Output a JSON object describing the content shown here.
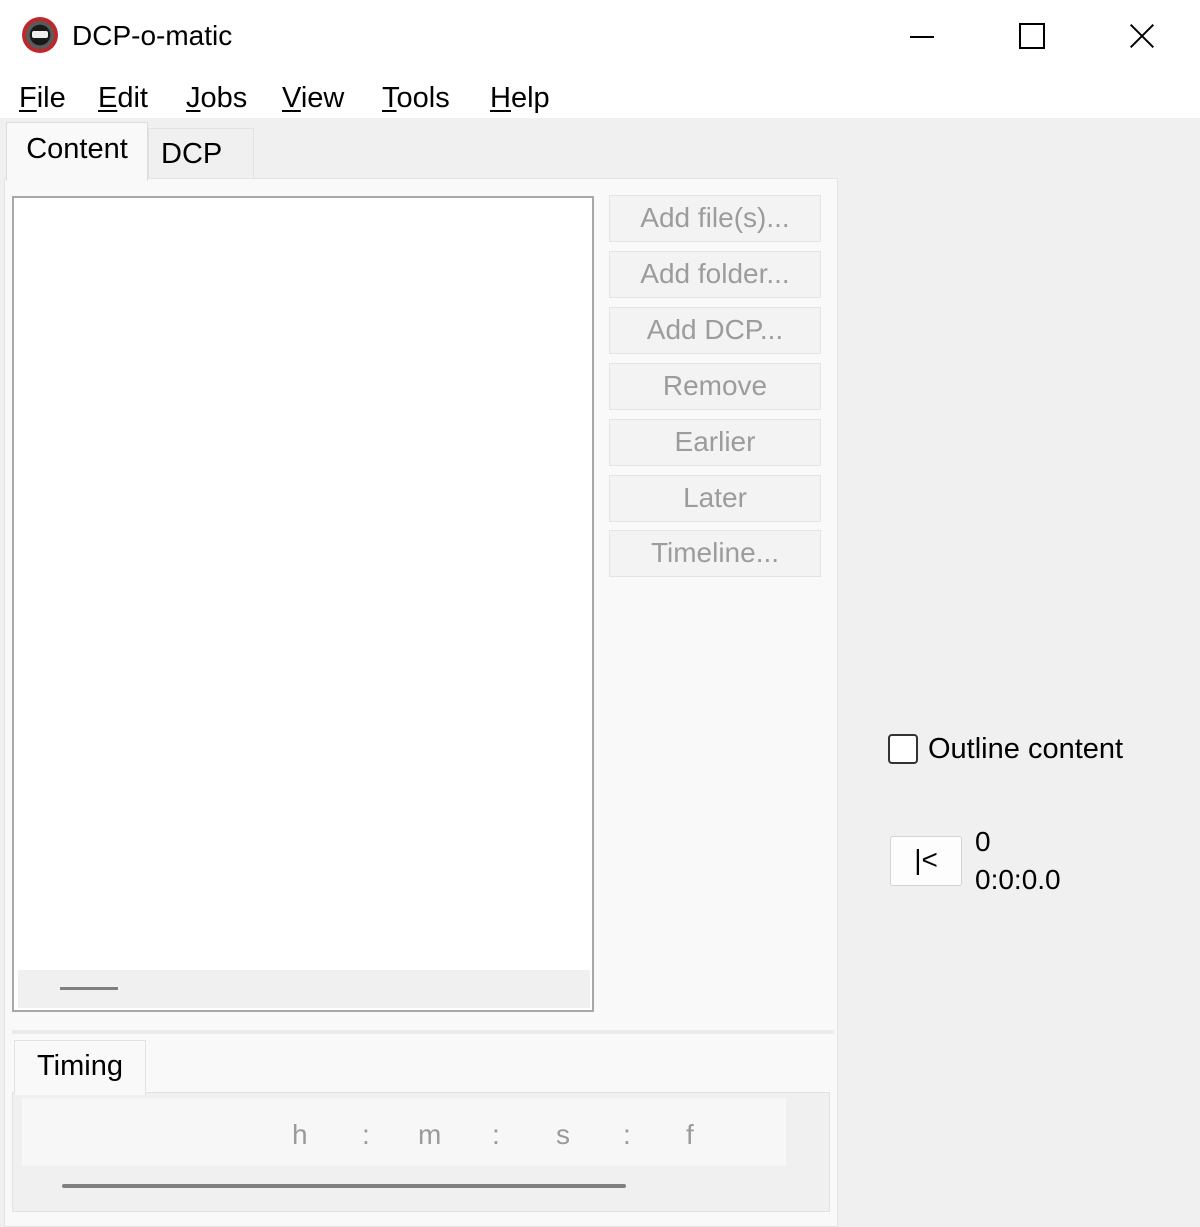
{
  "window": {
    "title": "DCP-o-matic"
  },
  "menubar": {
    "items": [
      {
        "label": "File",
        "mnemonic": "F",
        "rest": "ile"
      },
      {
        "label": "Edit",
        "mnemonic": "E",
        "rest": "dit"
      },
      {
        "label": "Jobs",
        "mnemonic": "J",
        "rest": "obs"
      },
      {
        "label": "View",
        "mnemonic": "V",
        "rest": "iew"
      },
      {
        "label": "Tools",
        "mnemonic": "T",
        "rest": "ools"
      },
      {
        "label": "Help",
        "mnemonic": "H",
        "rest": "elp"
      }
    ]
  },
  "tabs": {
    "content": "Content",
    "dcp": "DCP"
  },
  "content_buttons": {
    "add_files": "Add file(s)...",
    "add_folder": "Add folder...",
    "add_dcp": "Add DCP...",
    "remove": "Remove",
    "earlier": "Earlier",
    "later": "Later",
    "timeline": "Timeline..."
  },
  "timing": {
    "tab_label": "Timing",
    "labels": {
      "h": "h",
      "sep1": ":",
      "m": "m",
      "sep2": ":",
      "s": "s",
      "sep3": ":",
      "f": "f"
    }
  },
  "viewer": {
    "outline_label": "Outline content",
    "outline_checked": false,
    "rewind_label": "|<",
    "frame": "0",
    "timecode": "0:0:0.0"
  },
  "icons": {
    "app": "dcp-o-matic-logo-icon",
    "minimize": "minimize-icon",
    "maximize": "maximize-icon",
    "close": "close-icon"
  }
}
